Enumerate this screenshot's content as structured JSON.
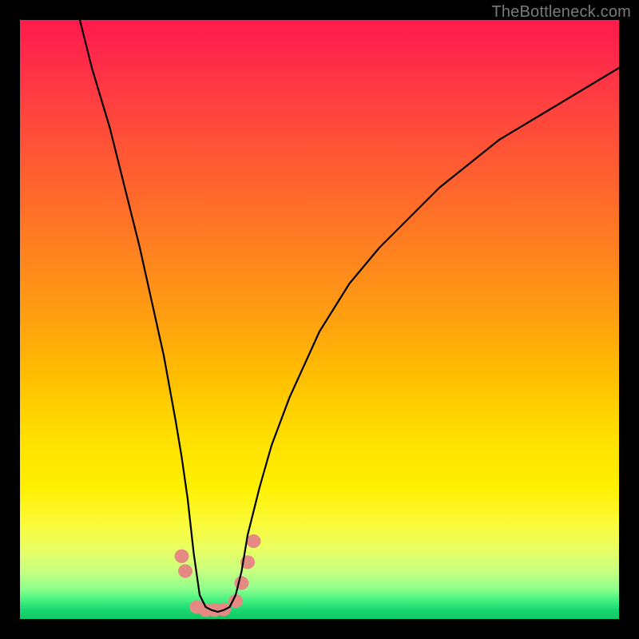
{
  "watermark": "TheBottleneck.com",
  "colors": {
    "frame_bg_top": "#ff1a4d",
    "frame_bg_bottom": "#10c862",
    "curve": "#000000",
    "markers": "#e58a82",
    "page_bg": "#000000",
    "watermark_text": "#7a7a7a"
  },
  "chart_data": {
    "type": "line",
    "title": "",
    "xlabel": "",
    "ylabel": "",
    "xlim": [
      0,
      100
    ],
    "ylim": [
      0,
      100
    ],
    "series": [
      {
        "name": "bottleneck-curve",
        "x": [
          10,
          12,
          15,
          18,
          20,
          22,
          24,
          26,
          27,
          28,
          29,
          30,
          31,
          32,
          33,
          34,
          35,
          36,
          37,
          38,
          40,
          42,
          45,
          50,
          55,
          60,
          65,
          70,
          75,
          80,
          85,
          90,
          95,
          100
        ],
        "y": [
          100,
          92,
          82,
          70,
          62,
          53,
          44,
          33,
          27,
          20,
          11,
          4,
          2,
          1.5,
          1.2,
          1.5,
          2,
          4,
          8,
          14,
          22,
          29,
          37,
          48,
          56,
          62,
          67,
          72,
          76,
          80,
          83,
          86,
          89,
          92
        ]
      }
    ],
    "markers": [
      {
        "x": 27.0,
        "y": 10.5
      },
      {
        "x": 27.6,
        "y": 8.0
      },
      {
        "x": 29.5,
        "y": 2.0
      },
      {
        "x": 31.0,
        "y": 1.5
      },
      {
        "x": 32.5,
        "y": 1.5
      },
      {
        "x": 34.0,
        "y": 1.6
      },
      {
        "x": 36.0,
        "y": 3.0
      },
      {
        "x": 37.0,
        "y": 6.0
      },
      {
        "x": 38.0,
        "y": 9.5
      },
      {
        "x": 39.0,
        "y": 13.0
      }
    ],
    "marker_radius_px": 9
  }
}
